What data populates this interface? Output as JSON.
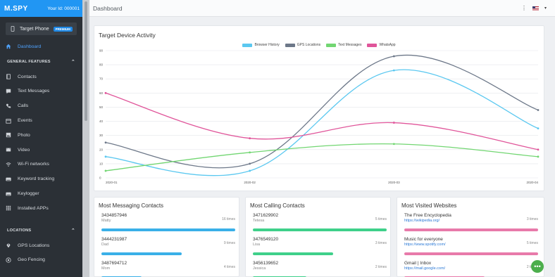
{
  "brand": {
    "logo": "M.SPY",
    "user_id": "Your Id: 000001"
  },
  "target_phone": {
    "label": "Target Phone",
    "badge": "PREMIUM"
  },
  "nav": {
    "dashboard": "Dashboard",
    "section_general": "GENERAL FEATURES",
    "items": [
      {
        "label": "Contacts",
        "icon": "book-icon"
      },
      {
        "label": "Text Messages",
        "icon": "message-icon"
      },
      {
        "label": "Calls",
        "icon": "phone-icon"
      },
      {
        "label": "Events",
        "icon": "calendar-icon"
      },
      {
        "label": "Photo",
        "icon": "image-icon"
      },
      {
        "label": "Video",
        "icon": "film-icon"
      },
      {
        "label": "Wi-Fi networks",
        "icon": "wifi-icon"
      },
      {
        "label": "Keyword tracking",
        "icon": "keyboard-icon"
      },
      {
        "label": "Keylogger",
        "icon": "keyboard-icon"
      },
      {
        "label": "Installed APPs",
        "icon": "apps-icon"
      }
    ],
    "section_locations": "LOCATIONS",
    "location_items": [
      {
        "label": "GPS Locations",
        "icon": "pin-icon"
      },
      {
        "label": "Geo Fencing",
        "icon": "target-icon"
      }
    ]
  },
  "header": {
    "title": "Dashboard",
    "menu": "⋮",
    "caret": "▾"
  },
  "chart_data": {
    "type": "line",
    "title": "Target Device Activity",
    "categories": [
      "2020-01",
      "2020-02",
      "2020-03",
      "2020-04"
    ],
    "ylim": [
      0,
      90
    ],
    "yticks": [
      0,
      10,
      20,
      30,
      40,
      50,
      60,
      70,
      80,
      90
    ],
    "grid": true,
    "legend": "top-center",
    "series": [
      {
        "name": "Browser History",
        "color": "#5bc8f0",
        "values": [
          15,
          5,
          76,
          35
        ]
      },
      {
        "name": "GPS Locations",
        "color": "#6d7889",
        "values": [
          25,
          10,
          86,
          48
        ]
      },
      {
        "name": "Text Messages",
        "color": "#72d672",
        "values": [
          5,
          18,
          24,
          15
        ]
      },
      {
        "name": "WhatsApp",
        "color": "#e0559a",
        "values": [
          60,
          28,
          39,
          20
        ]
      }
    ]
  },
  "messaging": {
    "title": "Most Messaging Contacts",
    "bar_color": "#3ab0e8",
    "entries": [
      {
        "number": "3434857946",
        "name": "Matty",
        "times": "16 times",
        "fill": 1.0
      },
      {
        "number": "3444231987",
        "name": "Dad",
        "times": "9 times",
        "fill": 0.6
      },
      {
        "number": "3487694712",
        "name": "Mom",
        "times": "4 times",
        "fill": 0.3
      }
    ]
  },
  "calling": {
    "title": "Most Calling Contacts",
    "bar_color": "#3fd08a",
    "entries": [
      {
        "number": "3471629902",
        "name": "Tetesa",
        "times": "5 times",
        "fill": 1.0
      },
      {
        "number": "3476549120",
        "name": "Lisa",
        "times": "3 times",
        "fill": 0.6
      },
      {
        "number": "3456139652",
        "name": "Jessica",
        "times": "2 times",
        "fill": 0.4
      }
    ]
  },
  "websites": {
    "title": "Most Visited Websites",
    "bar_color": "#e87aaa",
    "entries": [
      {
        "title": "The Free Encyclopedia",
        "url": "https://wikipedia.org/",
        "times": "3 times",
        "fill": 1.0
      },
      {
        "title": "Music for everyone",
        "url": "https://www.spotify.com/",
        "times": "5 times",
        "fill": 1.0
      },
      {
        "title": "Gmail | Inbox",
        "url": "https://mail.google.com/",
        "times": "2 times",
        "fill": 0.6
      }
    ]
  },
  "fab": {
    "label": "•••"
  }
}
